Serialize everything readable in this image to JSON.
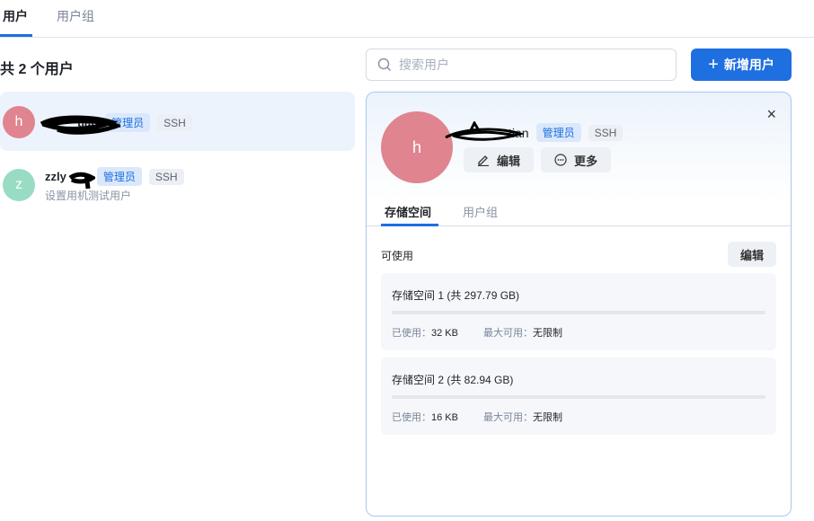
{
  "tabs": [
    {
      "label": "用户"
    },
    {
      "label": "用户组"
    }
  ],
  "count_label": "共 2 个用户",
  "search": {
    "placeholder": "搜索用户"
  },
  "add_button": "新增用户",
  "users": [
    {
      "initial": "h",
      "name": "tian",
      "avatar_color": "#e0848f",
      "badges": [
        "管理员",
        "SSH"
      ],
      "desc": ""
    },
    {
      "initial": "z",
      "name": "zzly",
      "avatar_color": "#98dcc4",
      "badges": [
        "管理员",
        "SSH"
      ],
      "desc": "设置用机测试用户"
    }
  ],
  "detail": {
    "initial": "h",
    "name": "tian",
    "badges": [
      "管理员",
      "SSH"
    ],
    "edit_button": "编辑",
    "more_button": "更多",
    "tabs": [
      "存储空间",
      "用户组"
    ],
    "available_label": "可使用",
    "edit_storage": "编辑",
    "storages": [
      {
        "title": "存储空间 1 (共 297.79 GB)",
        "used_label": "已使用：",
        "used": "32 KB",
        "max_label": "最大可用：",
        "max": "无限制",
        "used_fraction": 0.0
      },
      {
        "title": "存储空间 2 (共 82.94 GB)",
        "used_label": "已使用：",
        "used": "16 KB",
        "max_label": "最大可用：",
        "max": "无限制",
        "used_fraction": 0.0
      }
    ]
  }
}
